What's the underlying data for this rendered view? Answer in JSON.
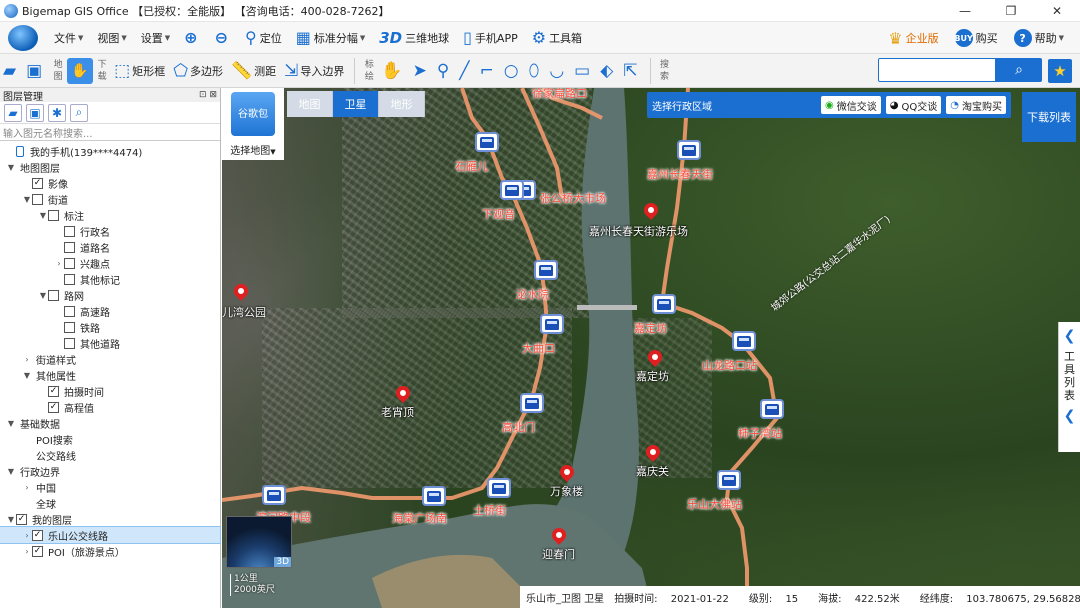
{
  "window": {
    "title": "Bigemap GIS Office 【已授权：全能版】 【咨询电话：400-028-7262】",
    "minimize": "—",
    "restore": "❐",
    "close": "✕"
  },
  "menu": {
    "file": "文件",
    "view": "视图",
    "settings": "设置",
    "locate": "定位",
    "standard_sheet": "标准分幅",
    "globe": "三维地球",
    "globe_3d": "3D",
    "mobile": "手机APP",
    "toolbox": "工具箱",
    "enterprise": "企业版",
    "buy": "购买",
    "buy_badge": "BUY",
    "help": "帮助"
  },
  "toolbar": {
    "group_map": "地图",
    "group_download": "下载",
    "rect": "矩形框",
    "polygon": "多边形",
    "measure": "测距",
    "import_boundary": "导入边界",
    "group_mark": "标绘",
    "group_search": "搜索",
    "search_placeholder": ""
  },
  "layer_panel": {
    "title": "图层管理",
    "ctrl": "⊡ ⊠",
    "search_placeholder": "输入图元名称搜索...",
    "rows": [
      {
        "level": 0,
        "toggle": "",
        "cb": null,
        "label": "我的手机(139****4474)",
        "phone": true
      },
      {
        "level": 0,
        "toggle": "▼",
        "cb": null,
        "label": "地图图层"
      },
      {
        "level": 1,
        "toggle": "",
        "cb": true,
        "label": "影像"
      },
      {
        "level": 1,
        "toggle": "▼",
        "cb": false,
        "label": "街道"
      },
      {
        "level": 2,
        "toggle": "▼",
        "cb": false,
        "label": "标注"
      },
      {
        "level": 3,
        "toggle": "",
        "cb": false,
        "label": "行政名"
      },
      {
        "level": 3,
        "toggle": "",
        "cb": false,
        "label": "道路名"
      },
      {
        "level": 3,
        "toggle": "›",
        "cb": false,
        "label": "兴趣点"
      },
      {
        "level": 3,
        "toggle": "",
        "cb": false,
        "label": "其他标记"
      },
      {
        "level": 2,
        "toggle": "▼",
        "cb": false,
        "label": "路网"
      },
      {
        "level": 3,
        "toggle": "",
        "cb": false,
        "label": "高速路"
      },
      {
        "level": 3,
        "toggle": "",
        "cb": false,
        "label": "铁路"
      },
      {
        "level": 3,
        "toggle": "",
        "cb": false,
        "label": "其他道路"
      },
      {
        "level": 1,
        "toggle": "›",
        "cb": null,
        "label": "街道样式"
      },
      {
        "level": 1,
        "toggle": "▼",
        "cb": null,
        "label": "其他属性"
      },
      {
        "level": 2,
        "toggle": "",
        "cb": true,
        "label": "拍摄时间"
      },
      {
        "level": 2,
        "toggle": "",
        "cb": true,
        "label": "高程值"
      },
      {
        "level": 0,
        "toggle": "▼",
        "cb": null,
        "label": "基础数据"
      },
      {
        "level": 1,
        "toggle": "",
        "cb": null,
        "label": "POI搜索"
      },
      {
        "level": 1,
        "toggle": "",
        "cb": null,
        "label": "公交路线"
      },
      {
        "level": 0,
        "toggle": "▼",
        "cb": null,
        "label": "行政边界"
      },
      {
        "level": 1,
        "toggle": "›",
        "cb": null,
        "label": "中国"
      },
      {
        "level": 1,
        "toggle": "",
        "cb": null,
        "label": "全球"
      },
      {
        "level": 0,
        "toggle": "▼",
        "cb": true,
        "label": "我的图层"
      },
      {
        "level": 1,
        "toggle": "›",
        "cb": true,
        "label": "乐山公交线路",
        "selected": true
      },
      {
        "level": 1,
        "toggle": "›",
        "cb": true,
        "label": "POI（旅游景点）"
      }
    ]
  },
  "map": {
    "select_map_icon": "谷歌包",
    "select_map": "选择地图",
    "tabs": [
      "地图",
      "卫星",
      "地形"
    ],
    "active_tab": 1,
    "region_select": "选择行政区域",
    "wechat": "微信交谈",
    "qq": "QQ交谈",
    "taobao": "淘宝购买",
    "download_list": "下载列表",
    "tool_list": "工具列表",
    "minimap_3d": "3D",
    "scale": [
      "1公里",
      "2000英尺"
    ],
    "status": {
      "region": "乐山市_卫图 卫星",
      "shoot_time_label": "拍摄时间:",
      "shoot_time": "2021-01-22",
      "level_label": "级别:",
      "level": "15",
      "elev_label": "海拔:",
      "elev": "422.52米",
      "coord_label": "经纬度:",
      "coord": "103.780675, 29.568286"
    },
    "stations": [
      {
        "name": "徐家扁路口"
      },
      {
        "name": "石雁儿"
      },
      {
        "name": "张公桥大市场"
      },
      {
        "name": "嘉州长春天街"
      },
      {
        "name": "下观音"
      },
      {
        "name": "泌水院"
      },
      {
        "name": "大曲口"
      },
      {
        "name": "嘉定坊"
      },
      {
        "name": "山龙路口站"
      },
      {
        "name": "高北门"
      },
      {
        "name": "柿子湾站"
      },
      {
        "name": "乐山大佛站"
      },
      {
        "name": "滨河路中段"
      },
      {
        "name": "海棠广场南"
      },
      {
        "name": "土桥街"
      }
    ],
    "pois": [
      {
        "name": "嘉州长春天街游乐场"
      },
      {
        "name": "儿湾公园"
      },
      {
        "name": "嘉定坊"
      },
      {
        "name": "老宵顶"
      },
      {
        "name": "嘉庆关"
      },
      {
        "name": "万象楼"
      },
      {
        "name": "迎春门"
      }
    ],
    "road_label": "城郊公路(公交总站二嘉华水泥厂)"
  },
  "colors": {
    "accent": "#1a6fd1",
    "route": "#f29a6e",
    "label_red": "#ff4c3b"
  }
}
